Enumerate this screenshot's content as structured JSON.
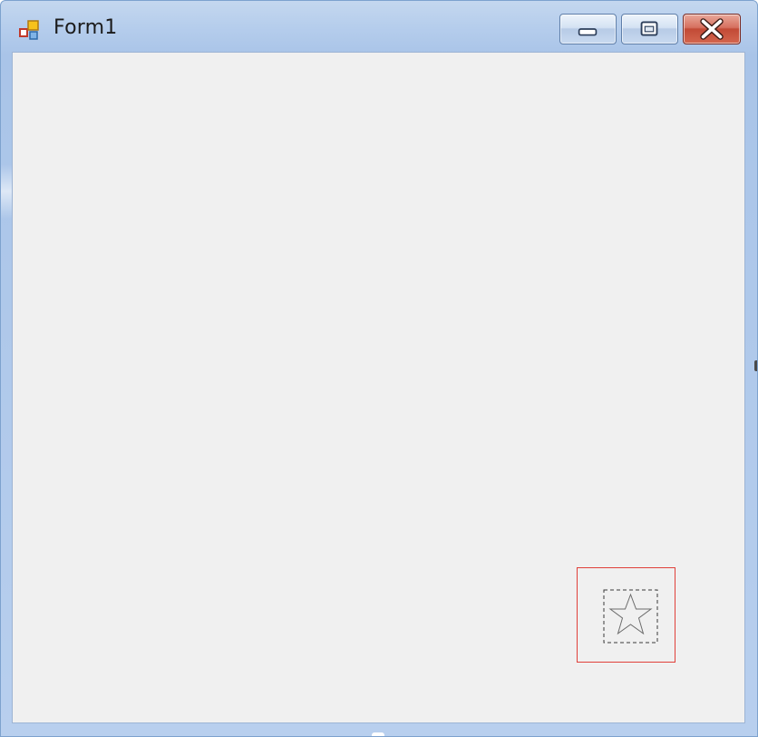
{
  "window": {
    "title": "Form1",
    "app_icon": "winforms-app-icon"
  },
  "caption_buttons": {
    "minimize_icon": "minimize-icon",
    "maximize_icon": "maximize-icon",
    "close_icon": "close-icon"
  },
  "client_area": {
    "picture_box": {
      "icon": "star-outline-icon",
      "border_color": "#e0403a"
    }
  },
  "colors": {
    "client_background": "#f0f0f0",
    "frame_accent": "#b5cdec",
    "close_button": "#c24a36"
  }
}
